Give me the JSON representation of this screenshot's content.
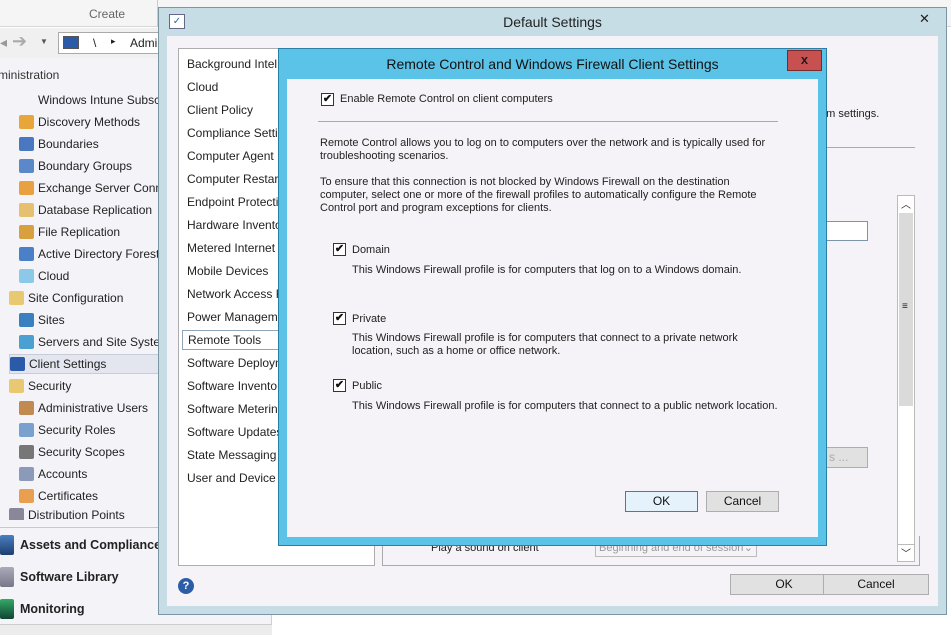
{
  "ribbon": {
    "create": "Create"
  },
  "navbar": {
    "path_sep": "\\",
    "path_arrow": "▸",
    "path_text": "Admi"
  },
  "left_nav": {
    "header": "ministration",
    "items": [
      "Windows Intune Subsc",
      "Discovery Methods",
      "Boundaries",
      "Boundary Groups",
      "Exchange Server Conn",
      "Database Replication",
      "File Replication",
      "Active Directory Forest",
      "Cloud",
      "Site Configuration",
      "Sites",
      "Servers and Site Syster",
      "Client Settings",
      "Security",
      "Administrative Users",
      "Security Roles",
      "Security Scopes",
      "Accounts",
      "Certificates",
      "Distribution Points"
    ],
    "workspaces": [
      "Assets and Compliance",
      "Software Library",
      "Monitoring"
    ]
  },
  "default_dialog": {
    "title": "Default Settings",
    "close": "✕",
    "categories": [
      "Background Intel",
      "Cloud",
      "Client Policy",
      "Compliance Setti",
      "Computer Agent",
      "Computer Restar",
      "Endpoint Protecti",
      "Hardware Invento",
      "Metered Internet",
      "Mobile Devices",
      "Network Access F",
      "Power Managem",
      "Remote Tools",
      "Software Deployn",
      "Software Invento",
      "Software Meterin",
      "Software Updates",
      "State Messaging",
      "User and Device A"
    ],
    "selected": "Remote Tools",
    "partial_text": "om settings.",
    "partial_button": "s ...",
    "play_sound_label": "Play a sound on client",
    "play_sound_value": "Beginning and end of session",
    "ok": "OK",
    "cancel": "Cancel",
    "help": "?"
  },
  "remote_dialog": {
    "title": "Remote Control and Windows Firewall Client Settings",
    "close": "x",
    "enable_label": "Enable Remote Control on client computers",
    "enable_checked": true,
    "para1": "Remote Control allows you to log on to computers over the network and is typically used for troubleshooting scenarios.",
    "para2": "To ensure that this connection is not blocked by Windows Firewall on the destination computer, select one or more of the firewall profiles to automatically configure the Remote Control port and program exceptions for clients.",
    "profiles": [
      {
        "label": "Domain",
        "checked": true,
        "desc": "This Windows Firewall profile is for computers that log on to a Windows domain."
      },
      {
        "label": "Private",
        "checked": true,
        "desc": "This Windows Firewall profile is for computers that connect to a private network location, such as a home or office network."
      },
      {
        "label": "Public",
        "checked": true,
        "desc": "This Windows Firewall profile is for computers that connect to a public network location."
      }
    ],
    "check_mark": "✔",
    "ok": "OK",
    "cancel": "Cancel"
  }
}
